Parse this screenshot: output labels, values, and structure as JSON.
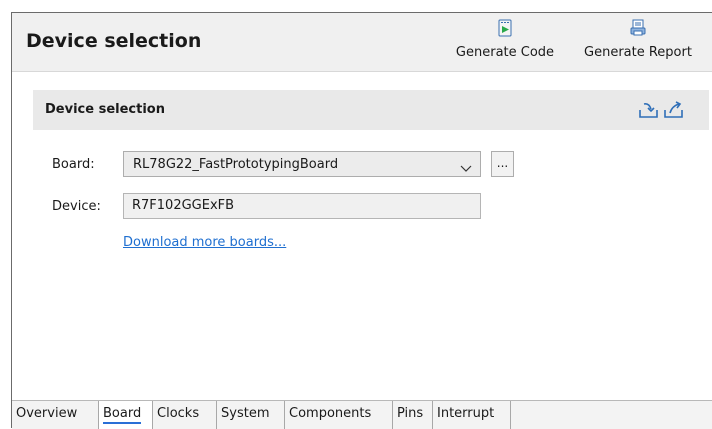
{
  "header": {
    "title": "Device selection",
    "toolbar": [
      {
        "label": "Generate Code",
        "icon": "generate-code-icon"
      },
      {
        "label": "Generate Report",
        "icon": "generate-report-icon"
      }
    ]
  },
  "section": {
    "title": "Device selection",
    "icons": [
      "import-icon",
      "export-icon"
    ]
  },
  "form": {
    "board_label": "Board:",
    "board_value": "RL78G22_FastPrototypingBoard",
    "browse_label": "...",
    "device_label": "Device:",
    "device_value": "R7F102GGExFB",
    "download_link": "Download more boards..."
  },
  "tabs": [
    {
      "label": "Overview",
      "active": false
    },
    {
      "label": "Board",
      "active": true
    },
    {
      "label": "Clocks",
      "active": false
    },
    {
      "label": "System",
      "active": false
    },
    {
      "label": "Components",
      "active": false
    },
    {
      "label": "Pins",
      "active": false
    },
    {
      "label": "Interrupt",
      "active": false
    }
  ],
  "colors": {
    "link": "#1f6fd0",
    "active_tab_underline": "#2a6fd6",
    "header_bg": "#f0f0f0",
    "section_bg": "#e9e9e9"
  }
}
